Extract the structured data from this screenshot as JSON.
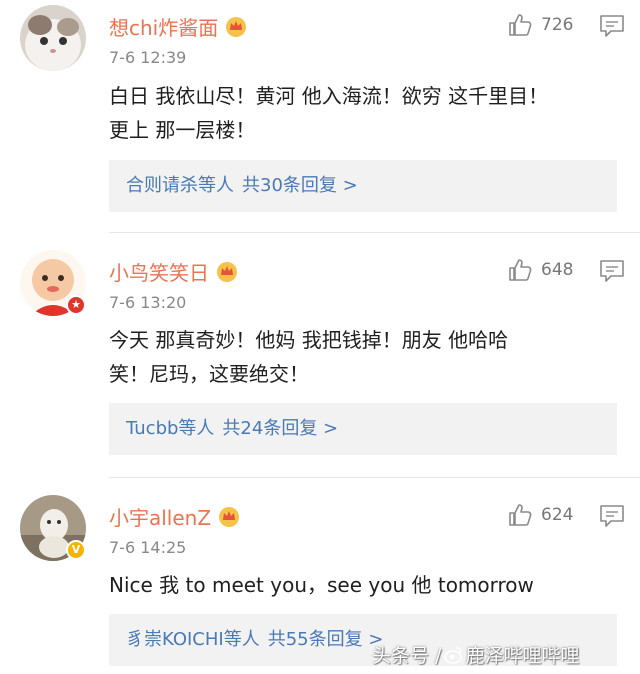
{
  "comments": [
    {
      "username": "想chi炸酱面",
      "time": "7-6 12:39",
      "likes": "726",
      "text": "白日 我依山尽！黄河 他入海流！欲穷 这千里目！\n更上 那一层楼！",
      "reply_names": "合则请杀等人",
      "reply_count": "共30条回复 >"
    },
    {
      "username": "小鸟笑笑日",
      "time": "7-6 13:20",
      "likes": "648",
      "text": "今天 那真奇妙！他妈 我把钱掉！朋友 他哈哈\n笑！尼玛，这要绝交！",
      "reply_names": "Tucbb等人",
      "reply_count": "共24条回复 >"
    },
    {
      "username": "小宇allenZ",
      "time": "7-6 14:25",
      "likes": "624",
      "text": "Nice 我 to meet you，see you 他 tomorrow",
      "reply_names": "豸崇KOICHI等人",
      "reply_count": "共55条回复 >"
    }
  ],
  "watermark": {
    "prefix": "头条号 /",
    "name": "鹿泽哔哩哔哩"
  },
  "colors": {
    "username": "#eb7350",
    "reply_link": "#4a79b3",
    "reply_bg": "#f2f2f2"
  }
}
